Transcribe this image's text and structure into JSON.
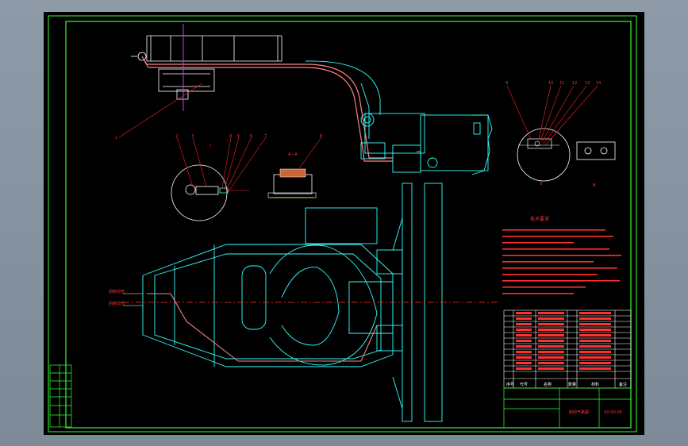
{
  "viewer": {
    "background_color": "#828f9d",
    "canvas_color": "#000000"
  },
  "colors": {
    "frame": "#33ff33",
    "outline": "#33ffff",
    "leader": "#ff2222",
    "centerline": "#ff3333",
    "pipe": "#ff8080",
    "axis": "#cc33ff",
    "white": "#ffffff",
    "yellow": "#ffff33"
  },
  "drawing": {
    "tech_title": "技术要求",
    "views": {
      "section_aa": "A—A",
      "detail_1": "Ⅰ",
      "detail_1_scale": "1:2",
      "detail_2": "Ⅱ",
      "detail_2_scale": "1:2",
      "detail_3": "Ⅲ",
      "detail_3_scale": "1:5"
    },
    "balloons": [
      "1",
      "2",
      "3",
      "4",
      "5",
      "6",
      "7",
      "8",
      "9",
      "10",
      "11",
      "12",
      "13",
      "14"
    ],
    "side_labels": [
      "前制动管",
      "后制动管"
    ],
    "title_block": {
      "header_cells": [
        "序号",
        "代号",
        "名称",
        "数量",
        "材料",
        "备注"
      ],
      "drawing_name": "制动气路图",
      "drawing_code": "XX-00-00"
    }
  }
}
